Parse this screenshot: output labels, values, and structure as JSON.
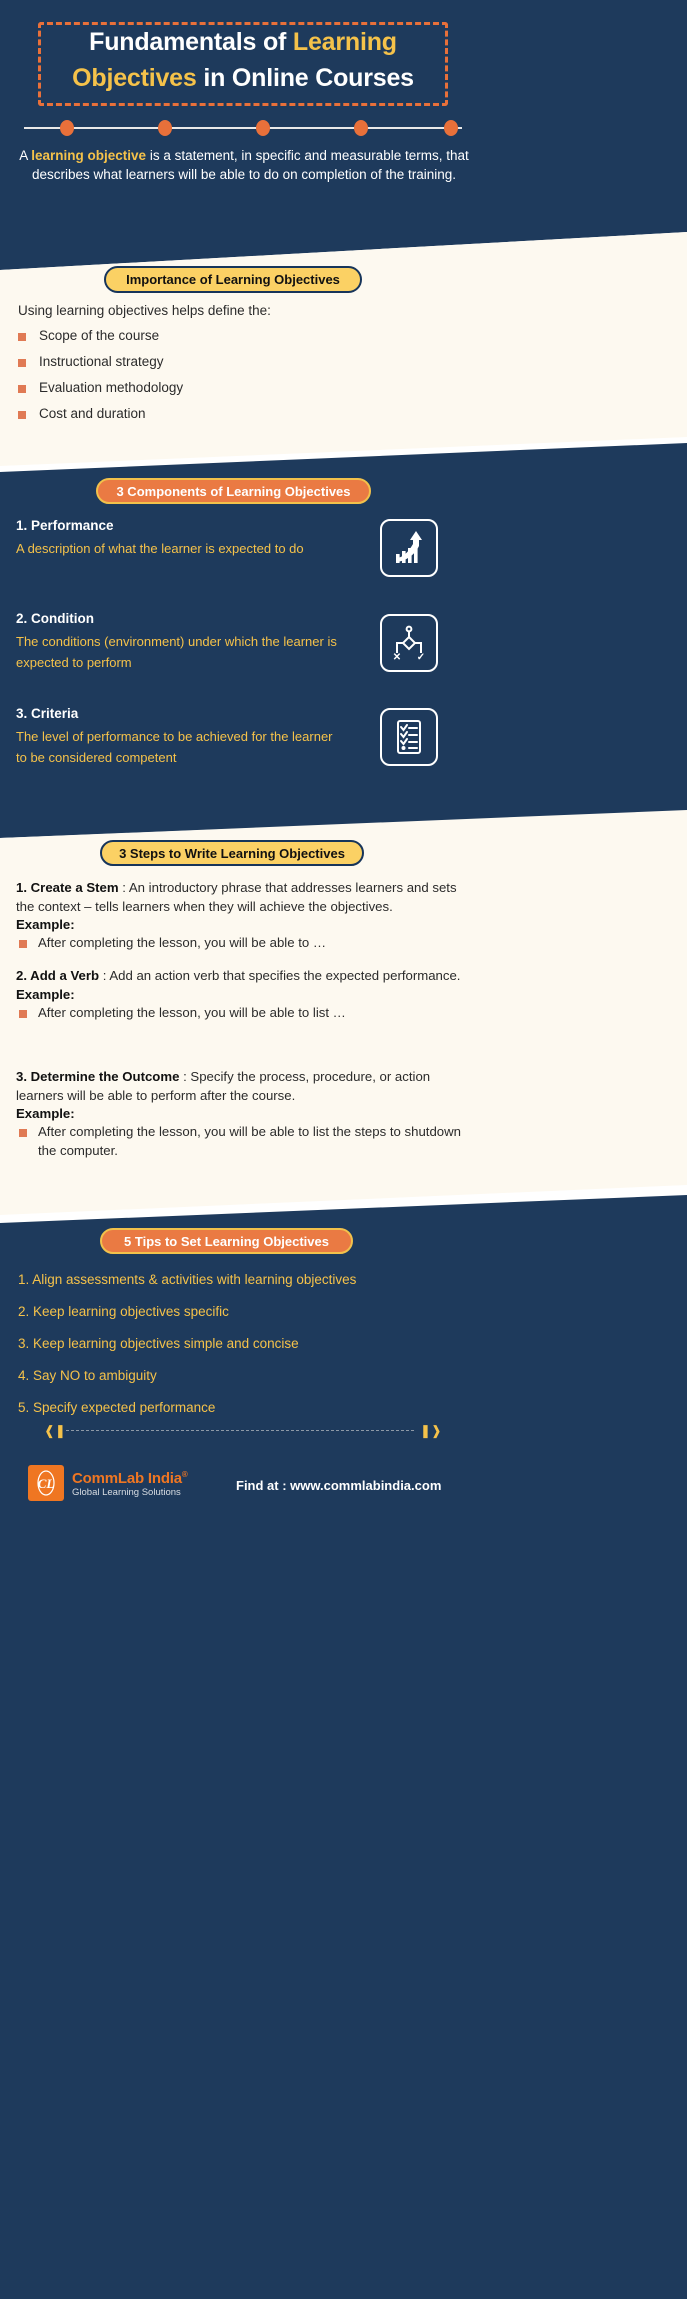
{
  "header": {
    "title_line1_a": "Fundamentals of ",
    "title_line1_b": "Learning",
    "title_line2_a": "Objectives",
    "title_line2_b": " in Online Courses",
    "intro_a": "A ",
    "intro_b": "learning objective",
    "intro_c": " is a statement, in specific and measurable terms, that describes what learners will be able to do on completion of the training."
  },
  "importance": {
    "pill": "Importance of Learning Objectives",
    "lead": "Using learning objectives helps define the:",
    "items": [
      "Scope of the course",
      "Instructional strategy",
      "Evaluation methodology",
      "Cost and duration"
    ]
  },
  "components": {
    "pill": "3 Components of Learning Objectives",
    "items": [
      {
        "title": "1. Performance",
        "desc": "A description of what the learner is expected to do",
        "icon": "growth-chart-icon"
      },
      {
        "title": "2. Condition",
        "desc": "The conditions (environment) under which the learner is expected to perform",
        "icon": "decision-tree-icon"
      },
      {
        "title": "3. Criteria",
        "desc": "The level of performance to be achieved for the learner to be considered competent",
        "icon": "checklist-icon"
      }
    ]
  },
  "steps": {
    "pill": "3 Steps to Write Learning Objectives",
    "example_label": "Example:",
    "items": [
      {
        "name": "1. Create a Stem",
        "body": " : An introductory phrase that addresses learners and sets the context – tells learners when they will achieve the objectives.",
        "example": "After completing the lesson, you will be able to …"
      },
      {
        "name": "2. Add a Verb",
        "body": " : Add an action verb that specifies the expected performance.",
        "example": "After completing the lesson, you will be able to list …"
      },
      {
        "name": "3. Determine the Outcome",
        "body": " : Specify the process, procedure, or action learners will be able to perform after the course.",
        "example": "After completing the lesson, you will be able to list the steps to shutdown the computer."
      }
    ]
  },
  "tips": {
    "pill": "5 Tips to Set Learning Objectives",
    "items": [
      "1. Align assessments & activities with learning objectives",
      "2. Keep learning objectives specific",
      "3. Keep learning objectives simple and concise",
      "4. Say NO to ambiguity",
      "5. Specify expected performance"
    ]
  },
  "footer": {
    "logo_mark": "CL",
    "brand": "CommLab India",
    "registered": "®",
    "tagline": "Global Learning Solutions",
    "find_at": "Find at : www.commlabindia.com"
  },
  "colors": {
    "navy": "#1e3a5c",
    "cream": "#fdf9f0",
    "orange": "#e8703a",
    "yellow": "#f5c24a",
    "pill_yellow": "#fbd164",
    "bullet": "#e07a54"
  }
}
